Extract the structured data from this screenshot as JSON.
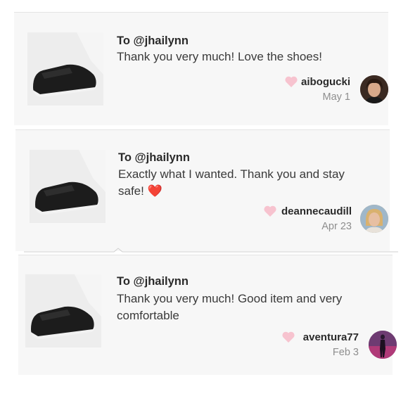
{
  "reviews": [
    {
      "to": "To @jhailynn",
      "message": "Thank you very much! Love the shoes!",
      "username": "aibogucki",
      "date": "May 1",
      "avatar_color": "#3b2a22"
    },
    {
      "to": "To @jhailynn",
      "message": "Exactly what I wanted. Thank you and stay safe! ❤️",
      "username": "deannecaudill",
      "date": "Apr 23",
      "avatar_color": "#c9a46a"
    },
    {
      "to": "To @jhailynn",
      "message": "Thank you very much! Good item and very comfortable",
      "username": "aventura77",
      "date": "Feb 3",
      "avatar_color": "#7a3a6a"
    }
  ],
  "colors": {
    "heart": "#f7c3cf",
    "card_bg": "#f7f7f7",
    "date_text": "#8e8e8e"
  },
  "icons": {
    "like": "heart-icon",
    "product": "shoe-photo"
  }
}
